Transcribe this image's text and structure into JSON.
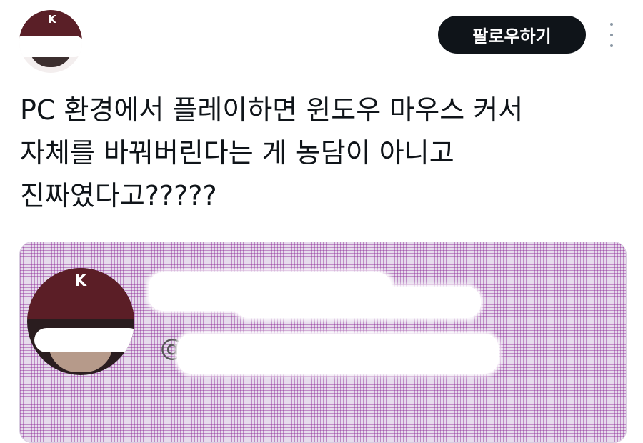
{
  "header": {
    "follow_label": "팔로우하기",
    "more_icon": "more-vertical-icon"
  },
  "tweet": {
    "text": "PC 환경에서 플레이하면 윈도우 마우스 커서\n자체를 바꿔버린다는 게 농담이 아니고\n진짜였다고?????"
  },
  "media": {
    "avatar_cap_letter": "K",
    "handle_prefix": "@"
  },
  "profile": {
    "avatar_cap_letter": "K"
  },
  "colors": {
    "button_bg": "#0f1419",
    "text": "#0f1419",
    "muted": "#8b98a5",
    "cap": "#5a1f27"
  }
}
